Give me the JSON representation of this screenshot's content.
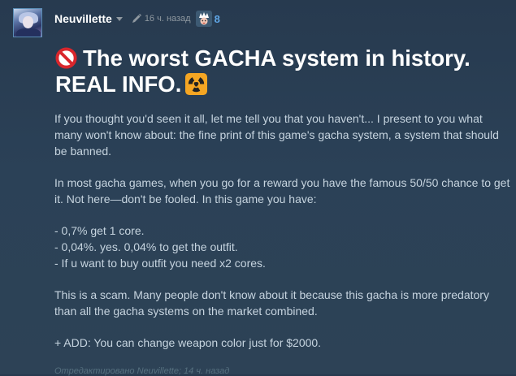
{
  "author": {
    "name": "Neuvillette"
  },
  "meta": {
    "time": "16 ч. назад",
    "award_count": "8"
  },
  "post": {
    "title": "The worst GACHA system in history. REAL INFO.",
    "paragraphs": [
      "If you thought you'd seen it all, let me tell you that you haven't... I present to you what many won't know about: the fine print of this game's gacha system, a system that should be banned.",
      "In most gacha games, when you go for a reward you have the famous 50/50 chance to get it. Not here—don't be fooled. In this game you have:",
      "- 0,7% get 1 core.\n- 0,04%. yes. 0,04% to get the outfit.\n- If u want to buy outfit you need x2 cores.",
      "This is a scam. Many people don't know about it because this gacha is more predatory than all the gacha systems on the market combined.",
      "+ ADD: You can change weapon color just for $2000."
    ],
    "edited": "Отредактировано Neuvillette; 14 ч. назад"
  }
}
